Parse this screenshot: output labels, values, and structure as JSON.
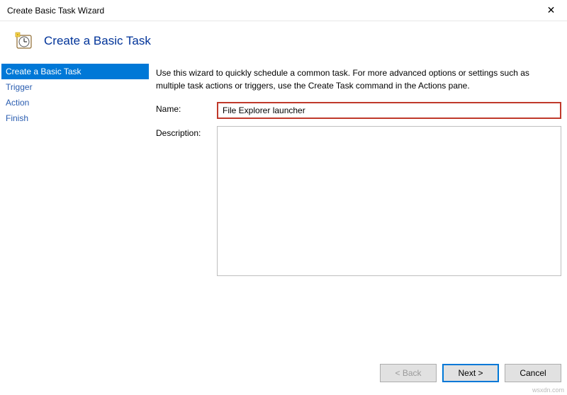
{
  "window": {
    "title": "Create Basic Task Wizard",
    "close_glyph": "✕"
  },
  "header": {
    "page_title": "Create a Basic Task",
    "icon_name": "scheduled-task-icon"
  },
  "sidebar": {
    "items": [
      {
        "label": "Create a Basic Task",
        "selected": true
      },
      {
        "label": "Trigger",
        "selected": false
      },
      {
        "label": "Action",
        "selected": false
      },
      {
        "label": "Finish",
        "selected": false
      }
    ]
  },
  "main": {
    "intro": "Use this wizard to quickly schedule a common task.  For more advanced options or settings such as multiple task actions or triggers, use the Create Task command in the Actions pane.",
    "name_label": "Name:",
    "name_value": "File Explorer launcher",
    "description_label": "Description:",
    "description_value": ""
  },
  "footer": {
    "back_label": "< Back",
    "next_label": "Next >",
    "cancel_label": "Cancel"
  },
  "watermark": "wsxdn.com"
}
